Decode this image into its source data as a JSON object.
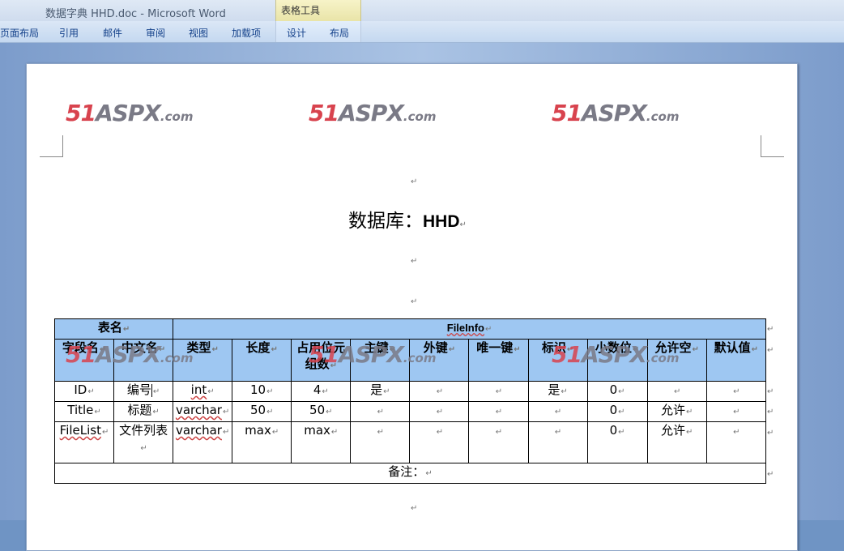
{
  "window": {
    "title": "数据字典 HHD.doc - Microsoft Word",
    "context_tab": "表格工具"
  },
  "ribbon": {
    "tabs": [
      "页面布局",
      "引用",
      "邮件",
      "审阅",
      "视图",
      "加载项"
    ],
    "context_tabs": [
      "设计",
      "布局"
    ]
  },
  "watermark": {
    "n51": "51",
    "asp": "ASPX",
    "dom": ".com"
  },
  "paragraph_mark": "↵",
  "document": {
    "heading_label": "数据库：",
    "heading_name": "HHD"
  },
  "table": {
    "table_name_label": "表名",
    "table_name_value": "FileInfo",
    "headers": [
      "字段名",
      "中文名",
      "类型",
      "长度",
      "占用位元组数",
      "主键",
      "外键",
      "唯一键",
      "标识",
      "小数位",
      "允许空",
      "默认值"
    ],
    "rows": [
      [
        "ID",
        "编号",
        "int",
        "10",
        "4",
        "是",
        "",
        "",
        "是",
        "0",
        "",
        ""
      ],
      [
        "Title",
        "标题",
        "varchar",
        "50",
        "50",
        "",
        "",
        "",
        "",
        "0",
        "允许",
        ""
      ],
      [
        "FileList",
        "文件列表",
        "varchar",
        "max",
        "max",
        "",
        "",
        "",
        "",
        "0",
        "允许",
        ""
      ]
    ],
    "note_label": "备注："
  }
}
